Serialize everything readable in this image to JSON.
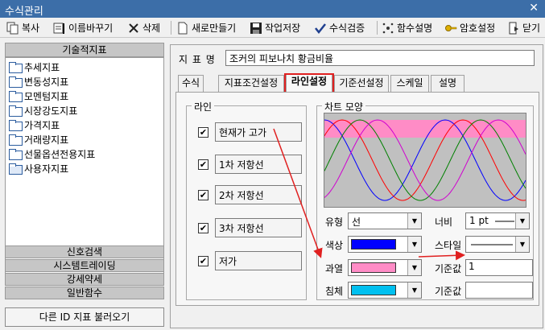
{
  "window": {
    "title": "수식관리",
    "close_glyph": "✕"
  },
  "toolbar": {
    "copy": "복사",
    "rename": "이름바꾸기",
    "delete": "삭제",
    "new": "새로만들기",
    "save": "작업저장",
    "verify": "수식검증",
    "func_desc": "함수설명",
    "password": "암호설정",
    "close": "닫기"
  },
  "sidebar": {
    "header": "기술적지표",
    "items": [
      "추세지표",
      "변동성지표",
      "모멘텀지표",
      "시장강도지표",
      "가격지표",
      "거래량지표",
      "선물옵션전용지표",
      "사용자지표"
    ],
    "categories": [
      "신호검색",
      "시스템트레이딩",
      "강세약세",
      "일반함수"
    ],
    "load_button": "다른 ID 지표 불러오기"
  },
  "indicator": {
    "name_label": "지 표 명",
    "name_value": "조커의 피보나치 황금비율"
  },
  "tabs": [
    "수식",
    "지표조건설정",
    "라인설정",
    "기준선설정",
    "스케일",
    "설명"
  ],
  "active_tab": "라인설정",
  "lines_group": {
    "title": "라인",
    "items": [
      {
        "label": "현재가 고가",
        "checked": true
      },
      {
        "label": "1차 저항선",
        "checked": true
      },
      {
        "label": "2차 저항선",
        "checked": true
      },
      {
        "label": "3차 저항선",
        "checked": true
      },
      {
        "label": "저가",
        "checked": true
      }
    ]
  },
  "chart_shape": {
    "title": "차트 모양",
    "type_label": "유형",
    "type_value": "선",
    "width_label": "너비",
    "width_value": "1 pt",
    "color_label": "색상",
    "color_value": "#0000ff",
    "style_label": "스타일",
    "overbought_label": "과열",
    "overbought_color": "#ff8cc6",
    "baseline1_label": "기준값",
    "baseline1_value": "1",
    "oversold_label": "침체",
    "oversold_color": "#00c0f0",
    "baseline2_label": "기준값",
    "baseline2_value": ""
  },
  "preview_colors": [
    "#0000ff",
    "#ff0000",
    "#008000",
    "#d000d0",
    "#ff8cc6"
  ],
  "highlight_color": "#e02020"
}
